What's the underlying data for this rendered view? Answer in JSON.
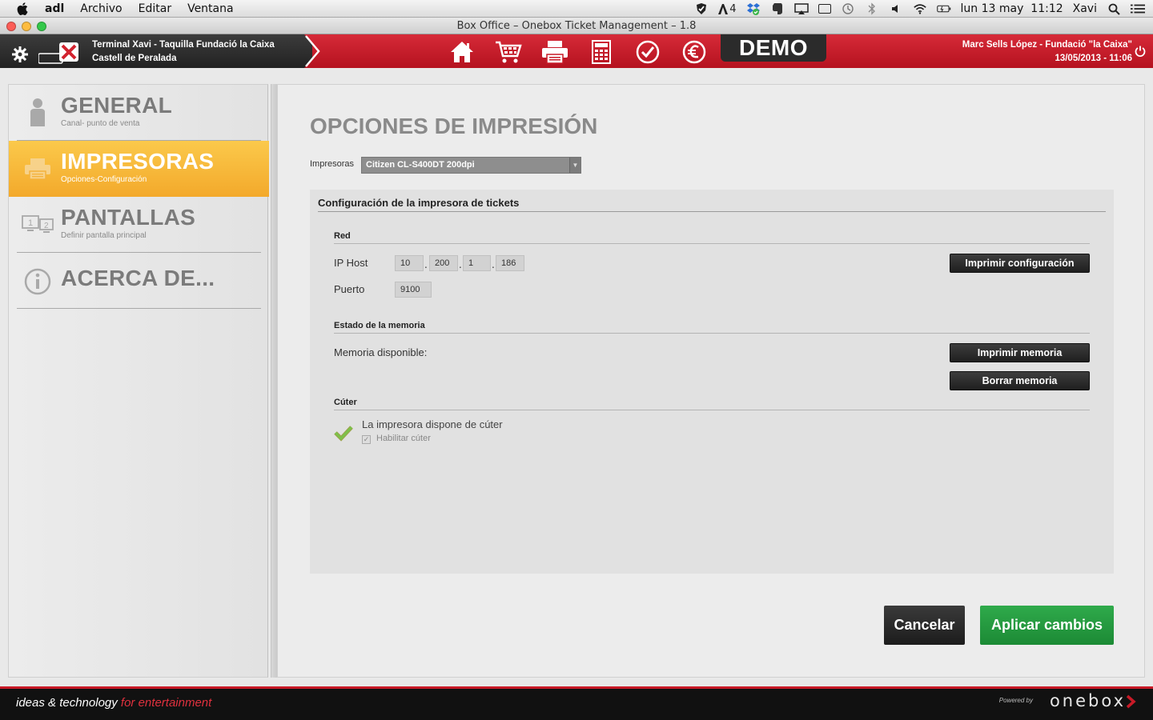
{
  "menubar": {
    "app_name": "adl",
    "items": [
      "Archivo",
      "Editar",
      "Ventana"
    ],
    "status": {
      "badge_count": "4",
      "datetime": "lun 13 may  11:12",
      "user": "Xavi"
    }
  },
  "window": {
    "title": "Box Office – Onebox Ticket Management – 1.8"
  },
  "header": {
    "terminal_line1": "Terminal Xavi - Taquilla  Fundació la Caixa",
    "terminal_line2": "Castell de  Peralada",
    "demo_label": "DEMO",
    "user_line1": "Marc Sells López - Fundació \"la Caixa\"",
    "user_line2": "13/05/2013 - 11:06",
    "nav_icons": [
      "home-icon",
      "cart-icon",
      "printer-icon",
      "calculator-icon",
      "check-icon",
      "euro-icon"
    ]
  },
  "sidebar": {
    "items": [
      {
        "title": "GENERAL",
        "subtitle": "Canal- punto de venta",
        "icon": "user-icon"
      },
      {
        "title": "IMPRESORAS",
        "subtitle": "Opciones-Configuración",
        "icon": "printer-icon"
      },
      {
        "title": "PANTALLAS",
        "subtitle": "Definir pantalla principal",
        "icon": "screens-icon"
      },
      {
        "title": "ACERCA DE...",
        "subtitle": "",
        "icon": "info-icon"
      }
    ]
  },
  "content": {
    "title": "OPCIONES DE IMPRESIÓN",
    "printer_label": "Impresoras",
    "printer_selected": "Citizen CL-S400DT 200dpi",
    "panel_title": "Configuración de la impresora de tickets",
    "red": {
      "section_title": "Red",
      "ip_label": "IP Host",
      "ip": [
        "10",
        "200",
        "1",
        "186"
      ],
      "port_label": "Puerto",
      "port": "9100",
      "print_config_button": "Imprimir configuración"
    },
    "memory": {
      "section_title": "Estado de la memoria",
      "available_label": "Memoria disponible:",
      "print_button": "Imprimir memoria",
      "clear_button": "Borrar memoria"
    },
    "cutter": {
      "section_title": "Cúter",
      "has_cutter_text": "La impresora dispone de cúter",
      "enable_label": "Habilitar cúter",
      "enable_checked": true
    },
    "cancel_button": "Cancelar",
    "apply_button": "Aplicar cambios"
  },
  "footer": {
    "tagline_main": "ideas & technology ",
    "tagline_accent": "for entertainment",
    "powered_by": "Powered by",
    "brand": "onebox"
  },
  "colors": {
    "header_red": "#c81a27",
    "active_orange": "#f6b234",
    "apply_green": "#22913a"
  }
}
